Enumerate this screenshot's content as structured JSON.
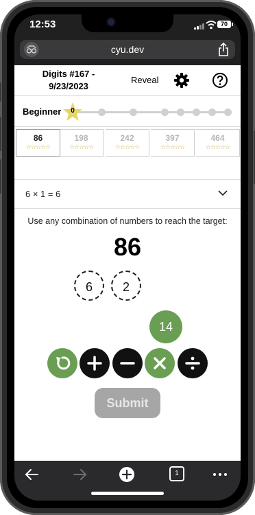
{
  "status_bar": {
    "time": "12:53",
    "battery": "70"
  },
  "browser": {
    "url": "cyu.dev"
  },
  "header": {
    "title_line1": "Digits #167 -",
    "title_line2": "9/23/2023",
    "reveal_label": "Reveal"
  },
  "level": {
    "label": "Beginner",
    "star_value": "0"
  },
  "puzzles": [
    {
      "target": "86",
      "stars": "☆☆☆☆☆"
    },
    {
      "target": "198",
      "stars": "☆☆☆☆☆"
    },
    {
      "target": "242",
      "stars": "☆☆☆☆☆"
    },
    {
      "target": "397",
      "stars": "☆☆☆☆☆"
    },
    {
      "target": "464",
      "stars": "☆☆☆☆☆"
    }
  ],
  "history": {
    "equation": "6 × 1 = 6"
  },
  "game": {
    "instructions": "Use any combination of numbers to reach the target:",
    "target": "86",
    "numbers": [
      "6",
      "2"
    ],
    "current_result": "14",
    "submit_label": "Submit"
  },
  "colors": {
    "accent_green": "#6a9f53",
    "button_dark": "#111111",
    "submit_disabled": "#a6a6a6"
  },
  "toolbar": {
    "tab_count": "1"
  }
}
